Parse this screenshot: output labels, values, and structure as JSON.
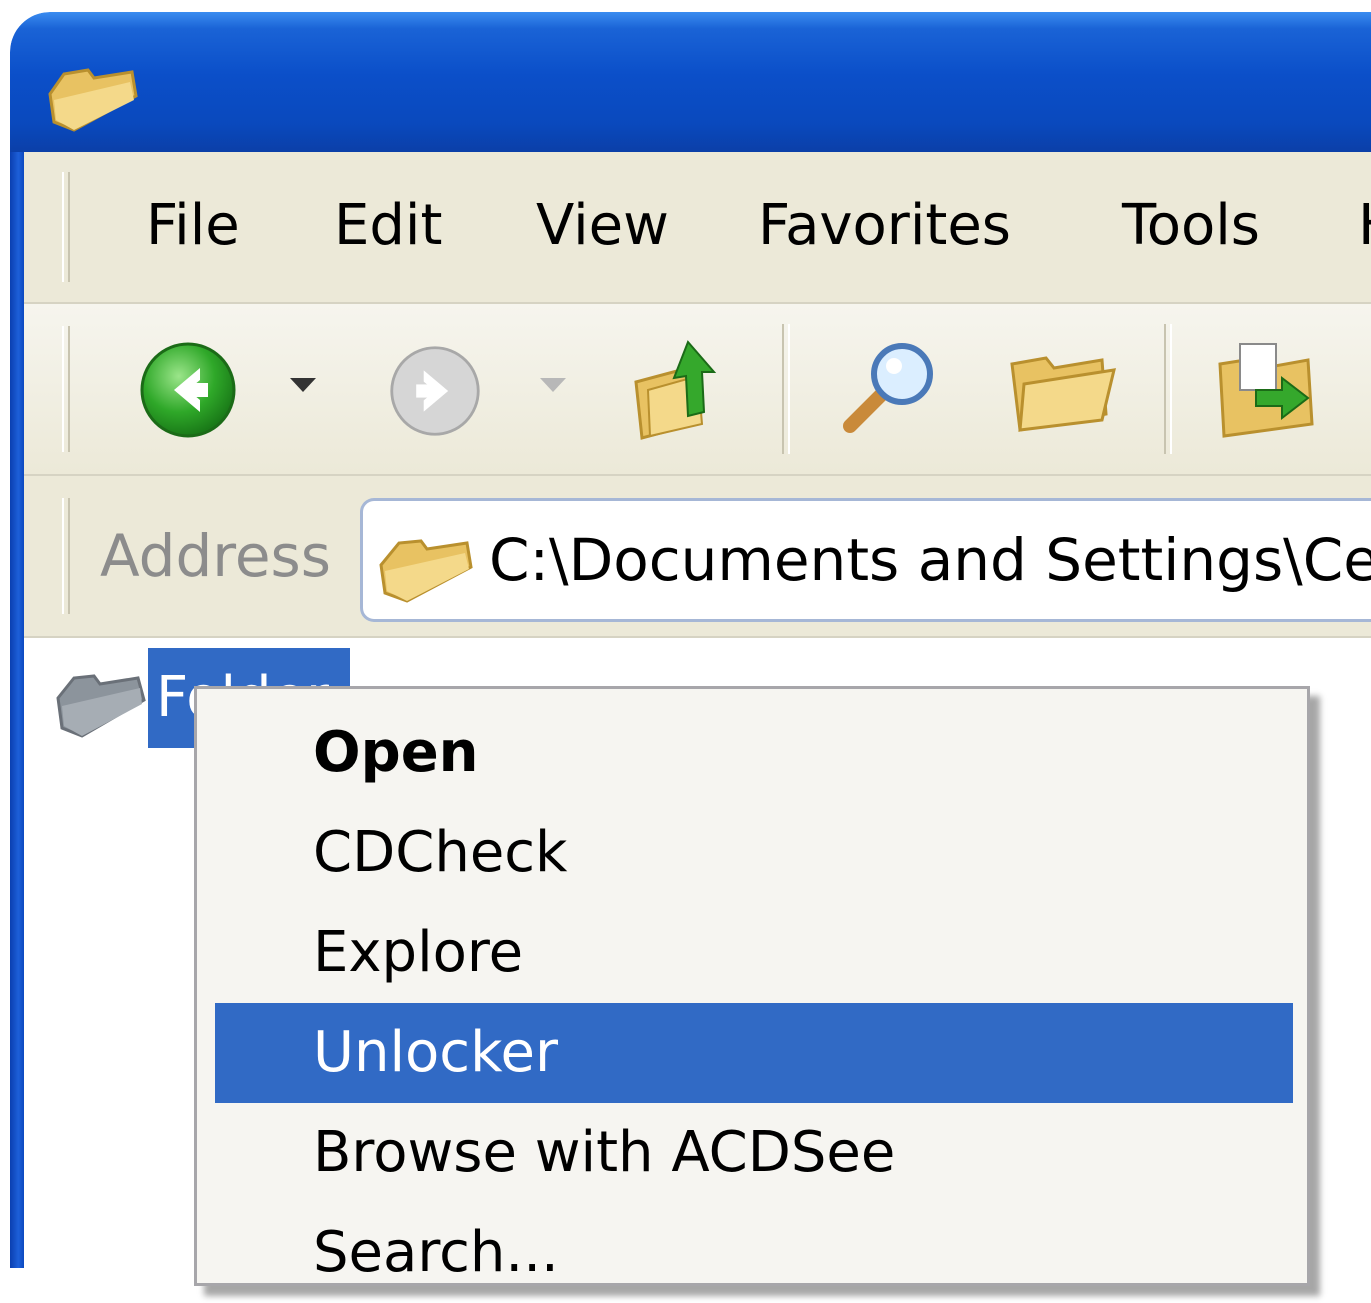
{
  "menubar": {
    "items": [
      "File",
      "Edit",
      "View",
      "Favorites",
      "Tools",
      "H"
    ]
  },
  "toolbar": {
    "buttons": [
      {
        "icon": "back-arrow-icon",
        "enabled": true
      },
      {
        "icon": "forward-arrow-icon",
        "enabled": false
      },
      {
        "icon": "up-folder-icon",
        "enabled": true
      },
      {
        "icon": "search-icon",
        "enabled": true
      },
      {
        "icon": "folders-icon",
        "enabled": true
      },
      {
        "icon": "move-to-icon",
        "enabled": true
      }
    ]
  },
  "address": {
    "label": "Address",
    "value": "C:\\Documents and Settings\\Ced"
  },
  "content": {
    "item_label": "Folder"
  },
  "context_menu": {
    "items": [
      {
        "label": "Open",
        "default": true,
        "selected": false
      },
      {
        "label": "CDCheck",
        "default": false,
        "selected": false
      },
      {
        "label": "Explore",
        "default": false,
        "selected": false
      },
      {
        "label": "Unlocker",
        "default": false,
        "selected": true
      },
      {
        "label": "Browse with ACDSee",
        "default": false,
        "selected": false
      },
      {
        "label": "Search...",
        "default": false,
        "selected": false
      }
    ]
  },
  "colors": {
    "titlebar": "#0a49bd",
    "selection": "#316ac5",
    "chrome": "#ece9d8"
  }
}
